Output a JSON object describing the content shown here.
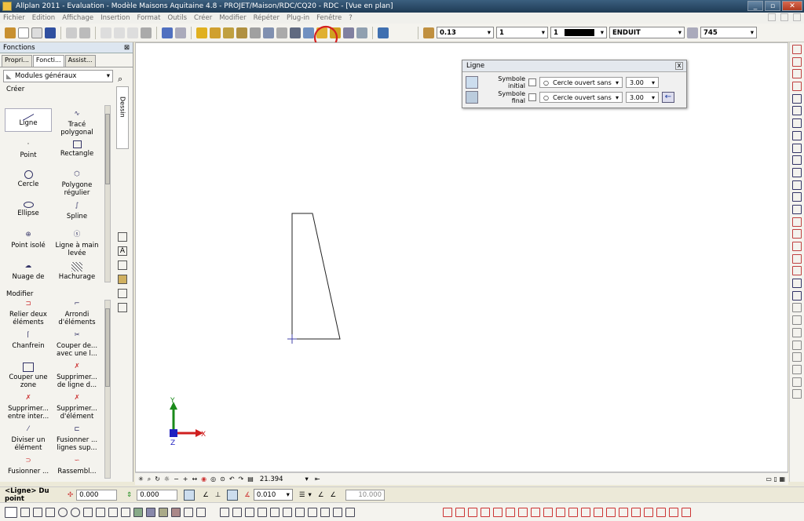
{
  "window": {
    "title": "Allplan 2011 - Evaluation - Modèle Maisons Aquitaine 4.8 - PROJET/Maison/RDC/CQ20 - RDC - [Vue en plan]",
    "min": "_",
    "max": "▫",
    "close": "✕"
  },
  "menu": [
    "Fichier",
    "Edition",
    "Affichage",
    "Insertion",
    "Format",
    "Outils",
    "Créer",
    "Modifier",
    "Répéter",
    "Plug-in",
    "Fenêtre",
    "?"
  ],
  "toolbar": {
    "pen_value": "0.13",
    "line_value": "1",
    "color_value": "1",
    "layer_value": "ENDUIT",
    "hatch_value": "745"
  },
  "annotation": {
    "label": "A",
    "color": "#d42020"
  },
  "sidebar": {
    "title": "Fonctions",
    "tabs": [
      "Propri...",
      "Foncti...",
      "Assist..."
    ],
    "module": "Modules généraux",
    "strip_label": "Dessin",
    "creer_title": "Créer",
    "creer_items": [
      "Ligne",
      "Tracé polygonal",
      "Point",
      "Rectangle",
      "Cercle",
      "Polygone régulier",
      "Ellipse",
      "Spline",
      "Point isolé",
      "Ligne à main levée",
      "Nuage de",
      "Hachurage"
    ],
    "modifier_title": "Modifier",
    "modifier_items": [
      "Relier deux éléments",
      "Arrondi d'éléments",
      "Chanfrein",
      "Couper de... avec une l...",
      "Couper une zone",
      "Supprimer... de ligne d...",
      "Supprimer... entre inter...",
      "Supprimer... d'élément",
      "Diviser un élément",
      "Fusionner ... lignes sup...",
      "Fusionner ...",
      "Rassembl..."
    ]
  },
  "dialog": {
    "title": "Ligne",
    "close": "x",
    "row1": {
      "label": "Symbole initial",
      "symbol": "Cercle ouvert sans",
      "size": "3.00"
    },
    "row2": {
      "label": "Symbole final",
      "symbol": "Cercle ouvert sans",
      "size": "3.00"
    }
  },
  "axes": {
    "x": "X",
    "y": "Y",
    "z": "Z"
  },
  "statusbar": {
    "zoom": "21.394"
  },
  "inputbar": {
    "prompt": "<Ligne> Du point",
    "dx": "0.000",
    "dy": "0.000",
    "angle": "0.010",
    "length": "10.000"
  }
}
